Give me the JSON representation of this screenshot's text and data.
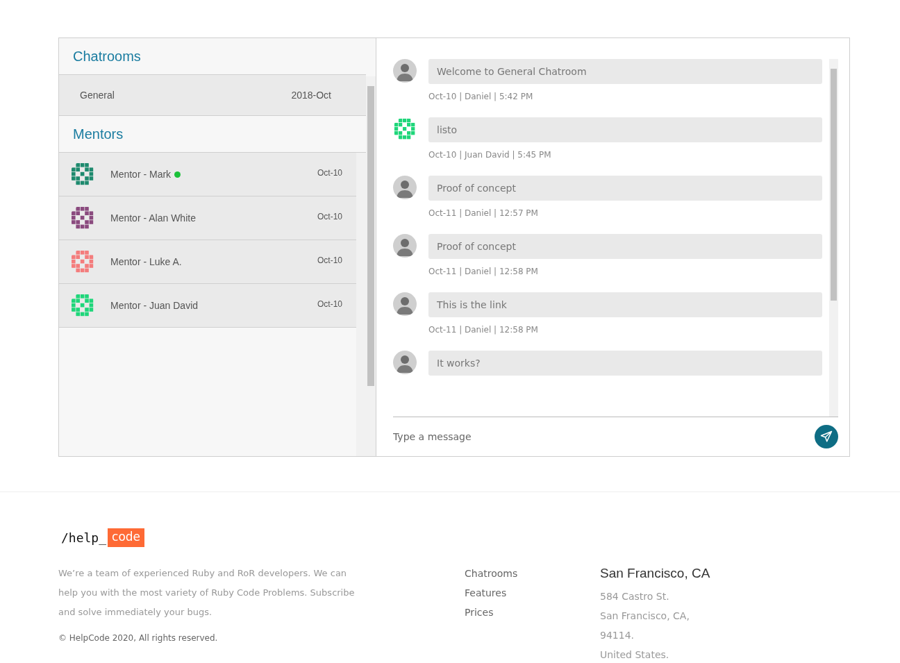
{
  "chatrooms": {
    "title": "Chatrooms",
    "items": [
      {
        "name": "General",
        "date": "2018-Oct",
        "selected": true
      }
    ]
  },
  "mentors": {
    "title": "Mentors",
    "items": [
      {
        "name": "Mentor - Mark",
        "date": "Oct-10",
        "online": true,
        "color": "#1e8a6e",
        "selected": false
      },
      {
        "name": "Mentor - Alan White",
        "date": "Oct-10",
        "online": false,
        "color": "#8a4a7e",
        "selected": false
      },
      {
        "name": "Mentor - Luke A.",
        "date": "Oct-10",
        "online": false,
        "color": "#f47c7c",
        "selected": false
      },
      {
        "name": "Mentor - Juan David",
        "date": "Oct-10",
        "online": false,
        "color": "#1fd67a",
        "selected": false
      }
    ]
  },
  "messages": [
    {
      "kind": "photo",
      "text": "Welcome to General Chatroom",
      "meta": "Oct-10 | Daniel | 5:42 PM"
    },
    {
      "kind": "identicon",
      "color": "#1fd67a",
      "text": "listo",
      "meta": "Oct-10 | Juan David | 5:45 PM"
    },
    {
      "kind": "photo",
      "text": "Proof of concept",
      "meta": "Oct-11 | Daniel | 12:57 PM"
    },
    {
      "kind": "photo",
      "text": "Proof of concept",
      "meta": "Oct-11 | Daniel | 12:58 PM"
    },
    {
      "kind": "photo",
      "text": "This is the link",
      "meta": "Oct-11 | Daniel | 12:58 PM"
    },
    {
      "kind": "photo",
      "text": "It works?"
    }
  ],
  "composer": {
    "placeholder": "Type a message"
  },
  "footer": {
    "logo": {
      "prefix": "/help_",
      "highlight": "code"
    },
    "about": "We’re a team of experienced Ruby and RoR developers. We can help you with the most variety of Ruby Code Problems. Subscribe and solve immediately your bugs.",
    "copyright": "© HelpCode 2020, All rights reserved.",
    "links": [
      "Chatrooms",
      "Features",
      "Prices"
    ],
    "address": {
      "title": "San Francisco, CA",
      "lines": [
        "584 Castro St.",
        "San Francisco, CA,",
        "94114.",
        "United States."
      ]
    }
  }
}
